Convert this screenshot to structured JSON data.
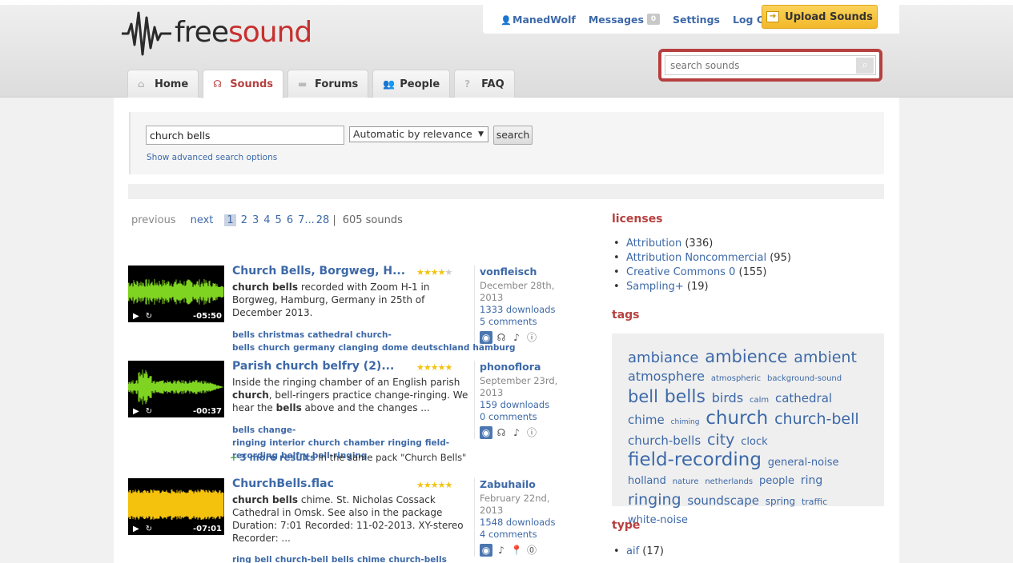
{
  "app": {
    "logo": {
      "free": "free",
      "sound": "sound"
    }
  },
  "user_menu": {
    "username": "ManedWolf",
    "messages_label": "Messages",
    "messages_count": "0",
    "settings_label": "Settings",
    "logout_label": "Log Out",
    "upload_label": "Upload Sounds"
  },
  "header_search": {
    "placeholder": "search sounds"
  },
  "tabs": [
    {
      "label": "Home",
      "icon": "home-icon"
    },
    {
      "label": "Sounds",
      "icon": "headphones-icon"
    },
    {
      "label": "Forums",
      "icon": "speech-bubble-icon"
    },
    {
      "label": "People",
      "icon": "people-icon"
    },
    {
      "label": "FAQ",
      "icon": "question-icon"
    }
  ],
  "search": {
    "query": "church bells",
    "sort_selected": "Automatic by relevance",
    "button_label": "search",
    "advanced_label": "Show advanced search options"
  },
  "pager": {
    "previous": "previous",
    "next": "next",
    "pages": [
      "1",
      "2",
      "3",
      "4",
      "5",
      "6",
      "7",
      "28"
    ],
    "ellipsis": "...",
    "total": "605 sounds"
  },
  "sounds": [
    {
      "title": "Church Bells, Borgweg, H...",
      "rating": 4,
      "desc_bold": "church bells",
      "desc_rest": " recorded with Zoom H-1 in Borgweg, Hamburg, Germany in 25th of December 2013.",
      "tags": [
        "bells",
        "christmas",
        "cathedral",
        "church-bells",
        "church",
        "germany",
        "clanging",
        "dome",
        "deutschland",
        "hamburg"
      ],
      "duration": "-05:50",
      "author": "vonfleisch",
      "date": "December 28th, 2013",
      "downloads": "1333 downloads",
      "comments": "5 comments",
      "wave_color": "#7fd321"
    },
    {
      "title": "Parish church belfry (2)...",
      "rating": 5,
      "desc_parts": [
        {
          "t": "Inside the ringing chamber of an English parish ",
          "b": false
        },
        {
          "t": "church",
          "b": true
        },
        {
          "t": ", bell-ringers practice change-ringing. We hear the ",
          "b": false
        },
        {
          "t": "bells",
          "b": true
        },
        {
          "t": " above and the changes ...",
          "b": false
        }
      ],
      "tags": [
        "bells",
        "change-ringing",
        "interior",
        "church",
        "chamber",
        "ringing",
        "field-recording",
        "belfry",
        "bell-ringing"
      ],
      "duration": "-00:37",
      "author": "phonoflora",
      "date": "September 23rd, 2013",
      "downloads": "159 downloads",
      "comments": "0 comments",
      "more_results": "3 more results",
      "more_rest": " in the same pack \"Church Bells\"",
      "wave_color": "#7fd321"
    },
    {
      "title": "ChurchBells.flac",
      "rating": 5,
      "desc_bold": "church bells",
      "desc_rest": " chime. St. Nicholas Cossack Cathedral in Omsk. See also in the package Duration: 7:01 Recorded: 11-02-2013. XY-stereo Recorder: ...",
      "tags": [
        "ring",
        "bell",
        "church-bell",
        "bells",
        "chime",
        "church-bells"
      ],
      "duration": "-07:01",
      "author": "Zabuhailo",
      "date": "February 22nd, 2013",
      "downloads": "1548 downloads",
      "comments": "4 comments",
      "wave_color": "#f4c20d"
    }
  ],
  "sidebar": {
    "licenses_title": "licenses",
    "licenses": [
      {
        "name": "Attribution",
        "count": "(336)"
      },
      {
        "name": "Attribution Noncommercial",
        "count": "(95)"
      },
      {
        "name": "Creative Commons 0",
        "count": "(155)"
      },
      {
        "name": "Sampling+",
        "count": "(19)"
      }
    ],
    "tags_title": "tags",
    "tags": [
      {
        "t": "ambiance",
        "s": 18
      },
      {
        "t": "ambience",
        "s": 21
      },
      {
        "t": "ambient",
        "s": 19
      },
      {
        "t": "atmosphere",
        "s": 16
      },
      {
        "t": "atmospheric",
        "s": 10
      },
      {
        "t": "background-sound",
        "s": 10
      },
      {
        "t": "bell",
        "s": 21
      },
      {
        "t": "bells",
        "s": 22
      },
      {
        "t": "birds",
        "s": 16
      },
      {
        "t": "calm",
        "s": 10
      },
      {
        "t": "cathedral",
        "s": 15
      },
      {
        "t": "chime",
        "s": 15
      },
      {
        "t": "chiming",
        "s": 9
      },
      {
        "t": "church",
        "s": 23
      },
      {
        "t": "church-bell",
        "s": 19
      },
      {
        "t": "church-bells",
        "s": 15
      },
      {
        "t": "city",
        "s": 19
      },
      {
        "t": "clock",
        "s": 13
      },
      {
        "t": "field-recording",
        "s": 23
      },
      {
        "t": "general-noise",
        "s": 13
      },
      {
        "t": "holland",
        "s": 13
      },
      {
        "t": "nature",
        "s": 10
      },
      {
        "t": "netherlands",
        "s": 10
      },
      {
        "t": "people",
        "s": 13
      },
      {
        "t": "ring",
        "s": 14
      },
      {
        "t": "ringing",
        "s": 19
      },
      {
        "t": "soundscape",
        "s": 15
      },
      {
        "t": "spring",
        "s": 12
      },
      {
        "t": "traffic",
        "s": 11
      },
      {
        "t": "white-noise",
        "s": 13
      }
    ],
    "type_title": "type",
    "types": [
      {
        "name": "aif",
        "count": "(17)"
      }
    ]
  }
}
